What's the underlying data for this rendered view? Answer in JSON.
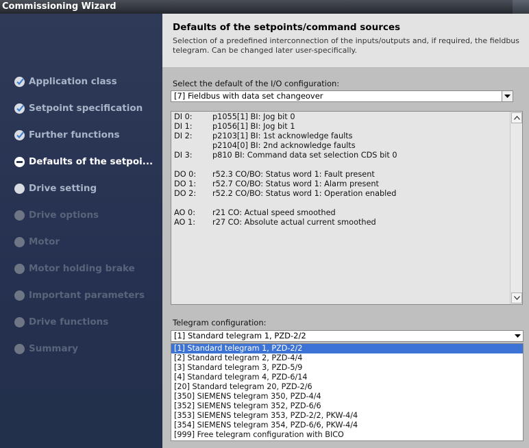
{
  "window": {
    "title": "Commissioning Wizard"
  },
  "sidebar": {
    "steps": [
      {
        "label": "Application class",
        "state": "done"
      },
      {
        "label": "Setpoint specification",
        "state": "done"
      },
      {
        "label": "Further functions",
        "state": "done"
      },
      {
        "label": "Defaults of the setpoi...",
        "state": "current"
      },
      {
        "label": "Drive setting",
        "state": "pending"
      },
      {
        "label": "Drive options",
        "state": "disabled"
      },
      {
        "label": "Motor",
        "state": "disabled"
      },
      {
        "label": "Motor holding brake",
        "state": "disabled"
      },
      {
        "label": "Important parameters",
        "state": "disabled"
      },
      {
        "label": "Drive functions",
        "state": "disabled"
      },
      {
        "label": "Summary",
        "state": "disabled"
      }
    ]
  },
  "header": {
    "title": "Defaults of the setpoints/command sources",
    "description": "Selection of a predefined interconnection of the inputs/outputs and, if required, the fieldbus telegram. Can be changed later user-specifically."
  },
  "io_config": {
    "label": "Select the default of the I/O configuration:",
    "selected": "[7] Fieldbus with data set changeover",
    "rows": [
      {
        "key": "DI 0:",
        "value": "p1055[1] BI: Jog bit 0"
      },
      {
        "key": "DI 1:",
        "value": "p1056[1] BI: Jog bit 1"
      },
      {
        "key": "DI 2:",
        "value": "p2103[1] BI: 1st acknowledge faults"
      },
      {
        "key": "",
        "value": "p2104[0] BI: 2nd acknowledge faults"
      },
      {
        "key": "DI 3:",
        "value": "p810 BI: Command data set selection CDS bit 0"
      },
      {
        "key": "DO 0:",
        "value": "r52.3 CO/BO: Status word 1: Fault present"
      },
      {
        "key": "DO 1:",
        "value": "r52.7 CO/BO: Status word 1: Alarm present"
      },
      {
        "key": "DO 2:",
        "value": "r52.2 CO/BO: Status word 1: Operation enabled"
      },
      {
        "key": "AO 0:",
        "value": "r21 CO: Actual speed smoothed"
      },
      {
        "key": "AO 1:",
        "value": "r27 CO: Absolute actual current smoothed"
      }
    ]
  },
  "telegram": {
    "label": "Telegram configuration:",
    "selected": "[1] Standard telegram 1, PZD-2/2",
    "options": [
      "[1] Standard telegram 1, PZD-2/2",
      "[2] Standard telegram 2, PZD-4/4",
      "[3] Standard telegram 3, PZD-5/9",
      "[4] Standard telegram 4, PZD-6/14",
      "[20] Standard telegram 20, PZD-2/6",
      "[350] SIEMENS telegram 350, PZD-4/4",
      "[352] SIEMENS telegram 352, PZD-6/6",
      "[353] SIEMENS telegram 353, PZD-2/2, PKW-4/4",
      "[354] SIEMENS telegram 354, PZD-6/6, PKW-4/4",
      "[999] Free telegram configuration with BICO"
    ],
    "highlighted_index": 0
  },
  "icons": {
    "done": "check-circle-icon",
    "current": "current-step-icon",
    "pending": "pending-circle-icon",
    "disabled": "disabled-circle-icon",
    "dropdown": "chevron-down-icon",
    "scroll_up": "scroll-up-icon",
    "scroll_down": "scroll-down-icon"
  },
  "colors": {
    "sidebar_bg": "#2b3550",
    "step_done_text": "#a8b4c8",
    "step_current_text": "#ffffff",
    "step_disabled_text": "#59647a",
    "selection": "#3c73d4"
  }
}
